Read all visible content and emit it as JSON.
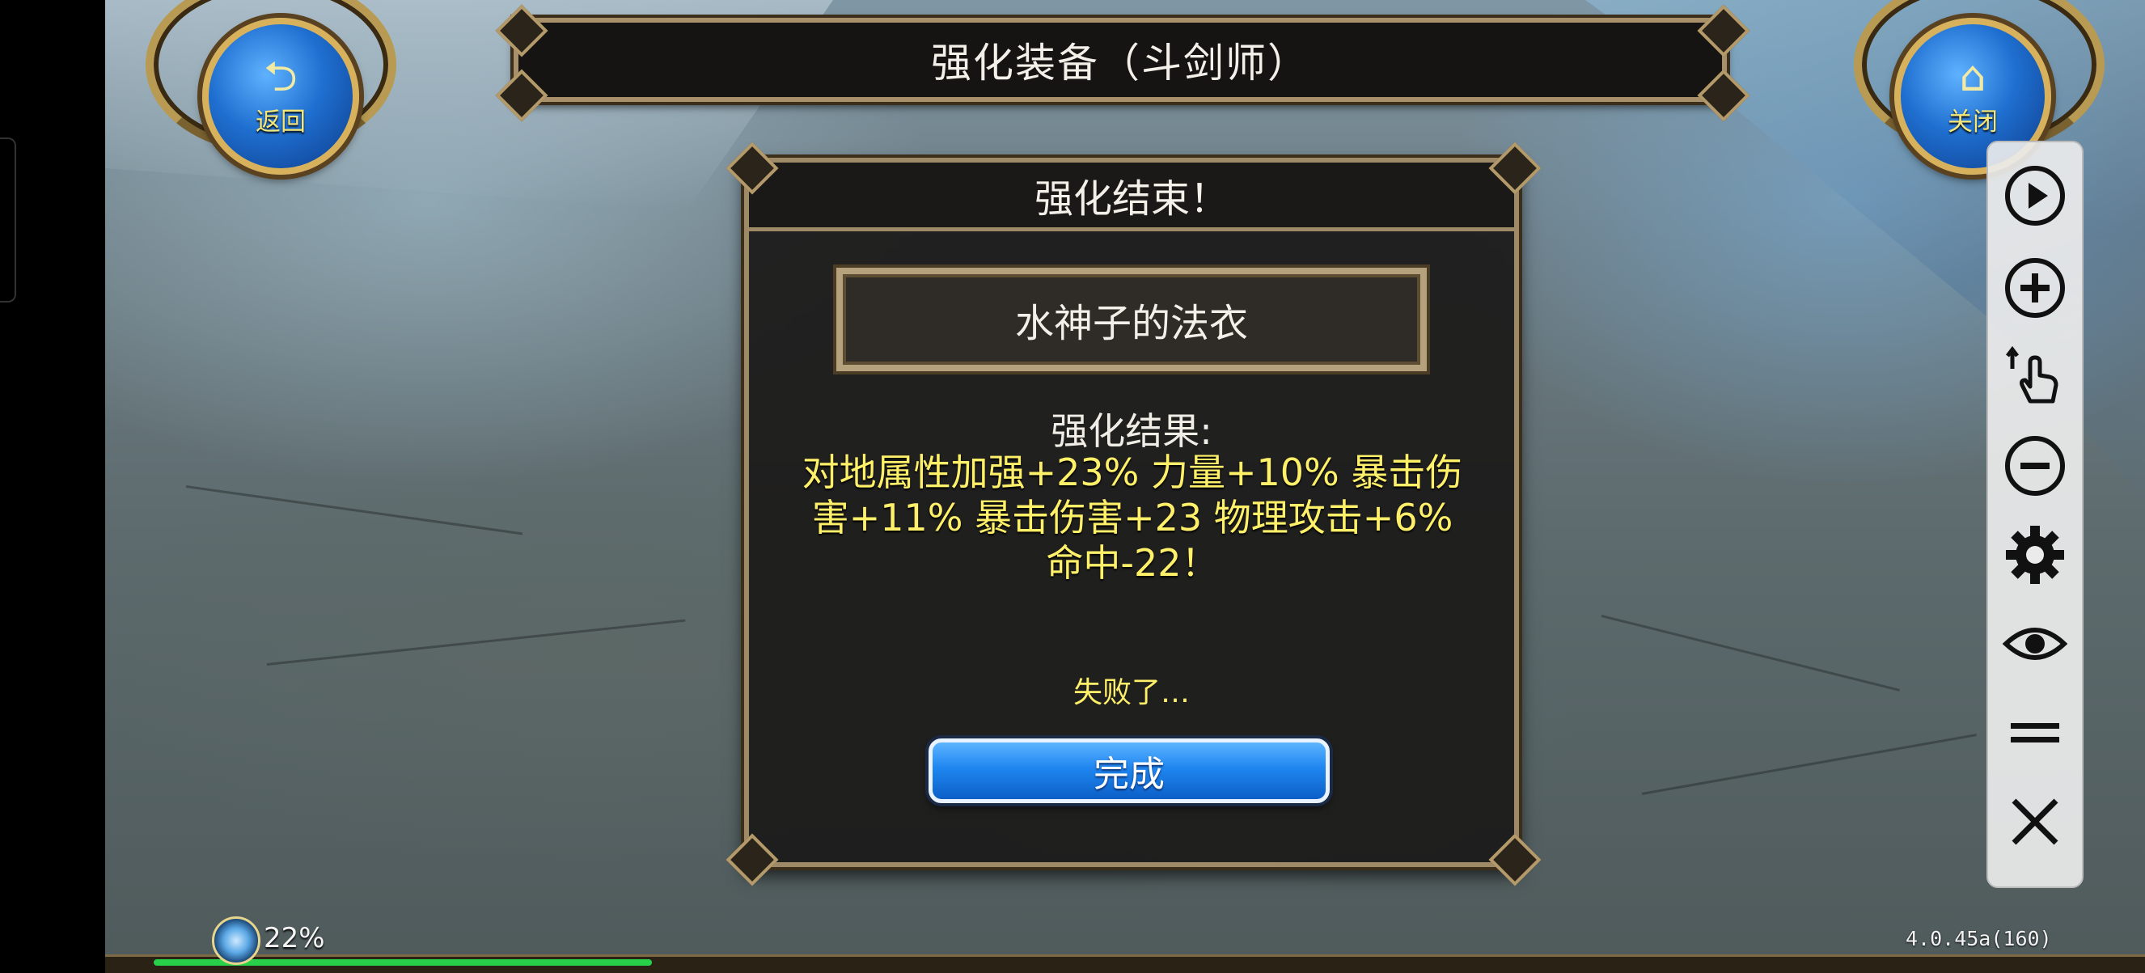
{
  "header": {
    "title": "强化装备（斗剑师）"
  },
  "nav": {
    "back_label": "返回",
    "back_glyph": "⮌",
    "close_label": "关闭",
    "close_glyph": "⌂"
  },
  "dialog": {
    "title": "强化结束！",
    "item_name": "水神子的法衣",
    "result_label": "强化结果:",
    "result_lines": [
      "对地属性加强+23% 力量+10% 暴击伤",
      "害+11% 暴击伤害+23 物理攻击+6%",
      "命中-22！"
    ],
    "fail_text": "失败了…",
    "done_label": "完成"
  },
  "toolbar": {
    "icons": [
      "play-icon",
      "zoom-in-icon",
      "tap-gesture-icon",
      "zoom-out-icon",
      "settings-icon",
      "eye-icon",
      "menu-icon",
      "close-icon"
    ]
  },
  "status": {
    "percent": "22%",
    "progress": 0.22,
    "version": "4.0.45a(160)"
  },
  "colors": {
    "result_text": "#fff06a",
    "button_blue": "#1f86f0",
    "frame_gold": "#9e8a66"
  }
}
